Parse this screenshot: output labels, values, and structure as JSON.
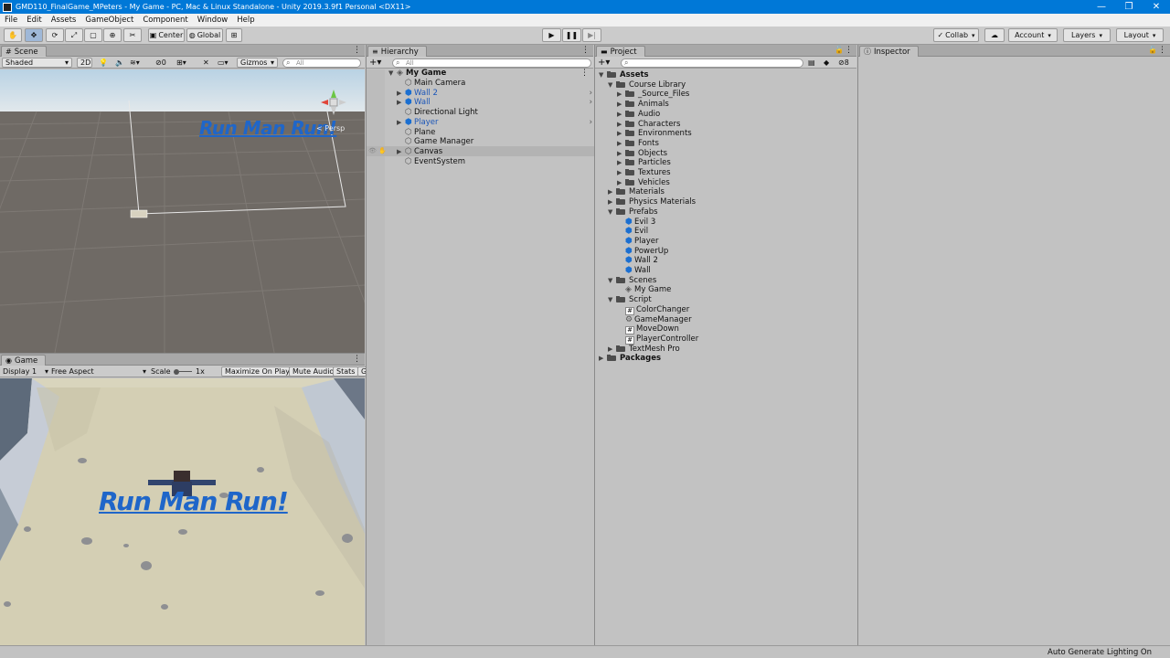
{
  "window": {
    "title": "GMD110_FinalGame_MPeters - My Game - PC, Mac & Linux Standalone - Unity 2019.3.9f1 Personal <DX11>",
    "minimize": "—",
    "maximize": "❐",
    "close": "✕"
  },
  "menu": [
    "File",
    "Edit",
    "Assets",
    "GameObject",
    "Component",
    "Window",
    "Help"
  ],
  "toolbar": {
    "pivot": "Center",
    "space": "Global",
    "collab": "Collab",
    "account": "Account",
    "layers": "Layers",
    "layout": "Layout"
  },
  "scene": {
    "tab": "Scene",
    "shading": "Shaded",
    "mode_2d": "2D",
    "hidden_count": "0",
    "gizmos": "Gizmos",
    "search_placeholder": "All",
    "persp": "< Persp",
    "canvas_text": "Run Man Run!"
  },
  "game": {
    "tab": "Game",
    "display": "Display 1",
    "aspect": "Free Aspect",
    "scale_label": "Scale",
    "scale_value": "1x",
    "maximize": "Maximize On Play",
    "mute": "Mute Audio",
    "stats": "Stats",
    "gizmos_cut": "G",
    "title_text": "Run Man Run!"
  },
  "hierarchy": {
    "tab": "Hierarchy",
    "search_placeholder": "All",
    "scene_name": "My Game",
    "items": [
      {
        "label": "Main Camera",
        "prefab": false,
        "expandable": false
      },
      {
        "label": "Wall 2",
        "prefab": true,
        "expandable": true
      },
      {
        "label": "Wall",
        "prefab": true,
        "expandable": true
      },
      {
        "label": "Directional Light",
        "prefab": false,
        "expandable": false
      },
      {
        "label": "Player",
        "prefab": true,
        "expandable": true
      },
      {
        "label": "Plane",
        "prefab": false,
        "expandable": false
      },
      {
        "label": "Game Manager",
        "prefab": false,
        "expandable": false
      },
      {
        "label": "Canvas",
        "prefab": false,
        "expandable": true
      },
      {
        "label": "EventSystem",
        "prefab": false,
        "expandable": false
      }
    ]
  },
  "project": {
    "tab": "Project",
    "hidden_count": "8",
    "tree": [
      {
        "label": "Assets",
        "depth": 0,
        "kind": "folder",
        "expanded": true,
        "bold": true
      },
      {
        "label": "Course Library",
        "depth": 1,
        "kind": "folder",
        "expanded": true
      },
      {
        "label": "_Source_Files",
        "depth": 2,
        "kind": "folder",
        "expanded": false
      },
      {
        "label": "Animals",
        "depth": 2,
        "kind": "folder",
        "expanded": false
      },
      {
        "label": "Audio",
        "depth": 2,
        "kind": "folder",
        "expanded": false
      },
      {
        "label": "Characters",
        "depth": 2,
        "kind": "folder",
        "expanded": false
      },
      {
        "label": "Environments",
        "depth": 2,
        "kind": "folder",
        "expanded": false
      },
      {
        "label": "Fonts",
        "depth": 2,
        "kind": "folder",
        "expanded": false
      },
      {
        "label": "Objects",
        "depth": 2,
        "kind": "folder",
        "expanded": false
      },
      {
        "label": "Particles",
        "depth": 2,
        "kind": "folder",
        "expanded": false
      },
      {
        "label": "Textures",
        "depth": 2,
        "kind": "folder",
        "expanded": false
      },
      {
        "label": "Vehicles",
        "depth": 2,
        "kind": "folder",
        "expanded": false
      },
      {
        "label": "Materials",
        "depth": 1,
        "kind": "folder",
        "expanded": false
      },
      {
        "label": "Physics Materials",
        "depth": 1,
        "kind": "folder",
        "expanded": false
      },
      {
        "label": "Prefabs",
        "depth": 1,
        "kind": "folder",
        "expanded": true
      },
      {
        "label": "Evil 3",
        "depth": 2,
        "kind": "prefab"
      },
      {
        "label": "Evil",
        "depth": 2,
        "kind": "prefab"
      },
      {
        "label": "Player",
        "depth": 2,
        "kind": "prefab"
      },
      {
        "label": "PowerUp",
        "depth": 2,
        "kind": "prefab"
      },
      {
        "label": "Wall 2",
        "depth": 2,
        "kind": "prefab"
      },
      {
        "label": "Wall",
        "depth": 2,
        "kind": "prefab"
      },
      {
        "label": "Scenes",
        "depth": 1,
        "kind": "folder",
        "expanded": true
      },
      {
        "label": "My Game",
        "depth": 2,
        "kind": "scene"
      },
      {
        "label": "Script",
        "depth": 1,
        "kind": "folder",
        "expanded": true
      },
      {
        "label": "ColorChanger",
        "depth": 2,
        "kind": "script"
      },
      {
        "label": "GameManager",
        "depth": 2,
        "kind": "gear"
      },
      {
        "label": "MoveDown",
        "depth": 2,
        "kind": "script"
      },
      {
        "label": "PlayerController",
        "depth": 2,
        "kind": "script"
      },
      {
        "label": "TextMesh Pro",
        "depth": 1,
        "kind": "folder",
        "expanded": false
      },
      {
        "label": "Packages",
        "depth": 0,
        "kind": "folder",
        "expanded": false,
        "bold": true
      }
    ]
  },
  "inspector": {
    "tab": "Inspector"
  },
  "status": {
    "text": "Auto Generate Lighting On"
  }
}
